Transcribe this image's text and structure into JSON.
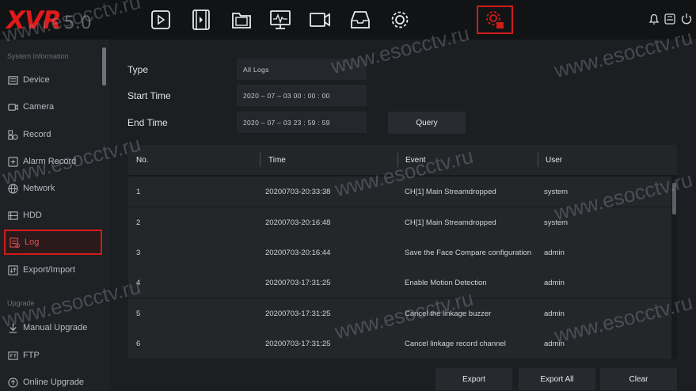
{
  "logo": {
    "brand": "XVR",
    "version": "5.0"
  },
  "topnav": [
    {
      "name": "playback-icon"
    },
    {
      "name": "video-film-icon"
    },
    {
      "name": "folder-icon"
    },
    {
      "name": "monitor-icon"
    },
    {
      "name": "camera-icon"
    },
    {
      "name": "storage-tray-icon"
    },
    {
      "name": "gear-icon"
    },
    {
      "name": "maintenance-gear-icon",
      "active": true
    }
  ],
  "sidebar": {
    "section_info": "System Information",
    "section_upgrade": "Upgrade",
    "items": [
      {
        "label": "Device"
      },
      {
        "label": "Camera"
      },
      {
        "label": "Record"
      },
      {
        "label": "Alarm Record"
      },
      {
        "label": "Network"
      },
      {
        "label": "HDD"
      },
      {
        "label": "Log"
      },
      {
        "label": "Export/Import"
      },
      {
        "label": "Manual Upgrade"
      },
      {
        "label": "FTP"
      },
      {
        "label": "Online Upgrade"
      }
    ]
  },
  "form": {
    "type_label": "Type",
    "type_value": "All Logs",
    "start_label": "Start Time",
    "start_value": "2020 – 07 – 03    00 : 00 : 00",
    "end_label": "End Time",
    "end_value": "2020 – 07 – 03    23 : 59 : 59",
    "query_label": "Query"
  },
  "table": {
    "columns": [
      "No.",
      "Time",
      "Event",
      "User"
    ],
    "rows": [
      {
        "no": "1",
        "time": "20200703-20:33:38",
        "event": "CH[1] Main Streamdropped",
        "user": "system"
      },
      {
        "no": "2",
        "time": "20200703-20:16:48",
        "event": "CH[1] Main Streamdropped",
        "user": "system"
      },
      {
        "no": "3",
        "time": "20200703-20:16:44",
        "event": "Save the Face Compare configuration",
        "user": "admin"
      },
      {
        "no": "4",
        "time": "20200703-17:31:25",
        "event": "Enable Motion Detection",
        "user": "admin"
      },
      {
        "no": "5",
        "time": "20200703-17:31:25",
        "event": "Cancel the linkage buzzer",
        "user": "admin"
      },
      {
        "no": "6",
        "time": "20200703-17:31:25",
        "event": "Cancel linkage record channel",
        "user": "admin"
      }
    ]
  },
  "buttons": {
    "export": "Export",
    "export_all": "Export All",
    "clear": "Clear"
  },
  "watermark": "www.esocctv.ru",
  "colors": {
    "accent": "#d11b1b",
    "background": "#1c1e22"
  }
}
